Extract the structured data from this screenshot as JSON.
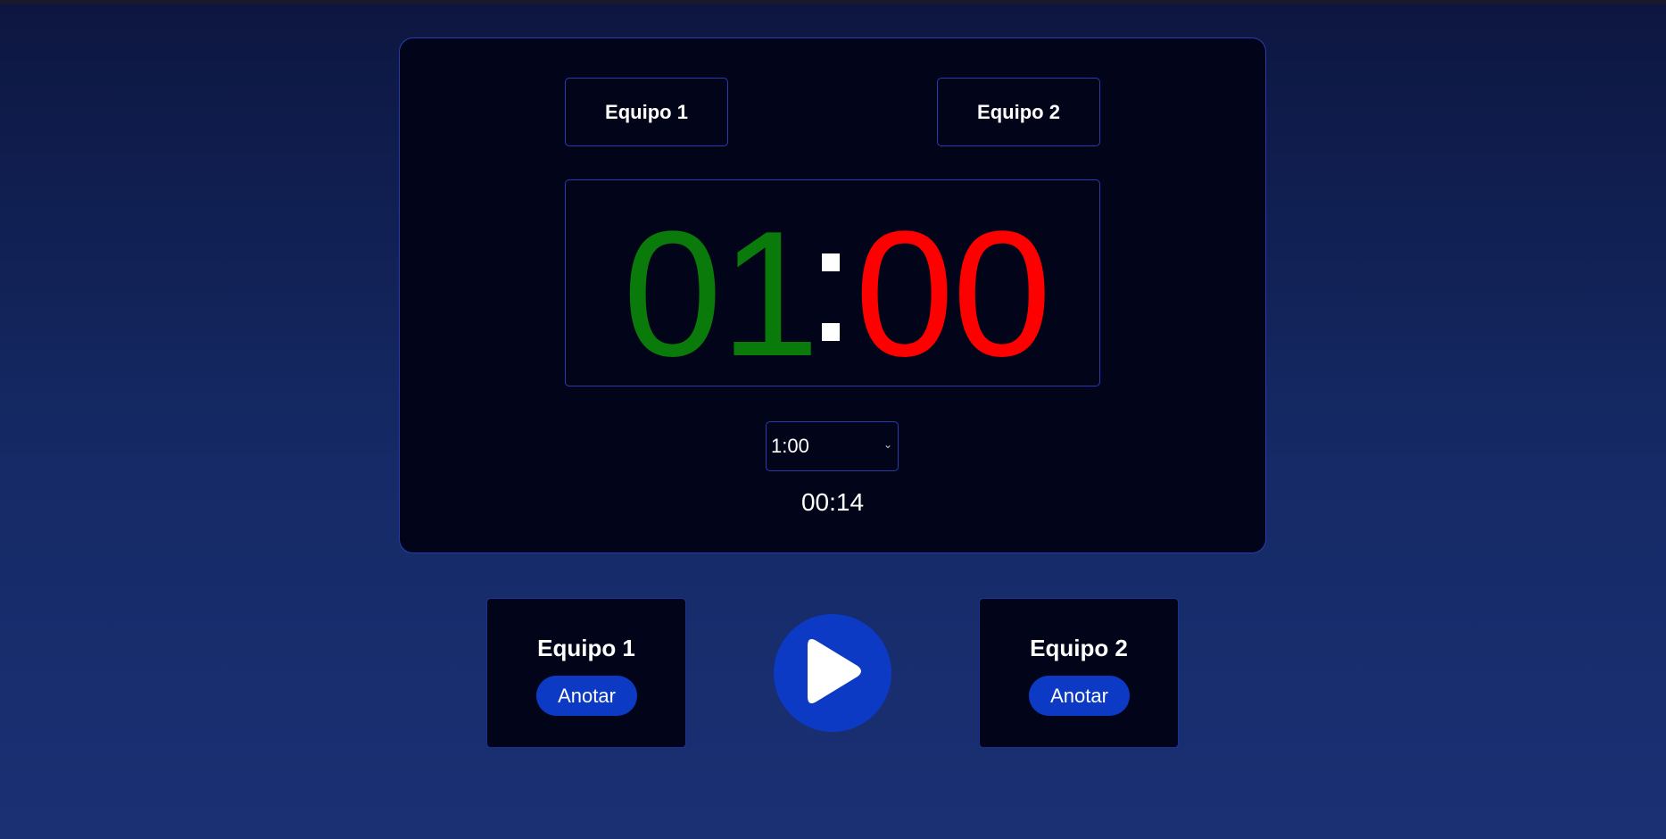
{
  "scoreboard": {
    "team1_name": "Equipo 1",
    "team2_name": "Equipo 2",
    "clock": {
      "minutes": "01",
      "seconds": "00",
      "minutes_color": "#0a7a0a",
      "seconds_color": "#ff0000"
    },
    "duration_select": {
      "selected": "1:00"
    },
    "elapsed": "00:14"
  },
  "controls": {
    "team1": {
      "title": "Equipo 1",
      "score_label": "Anotar"
    },
    "team2": {
      "title": "Equipo 2",
      "score_label": "Anotar"
    },
    "play_icon": "play-icon",
    "accent_color": "#0c3ac4"
  }
}
